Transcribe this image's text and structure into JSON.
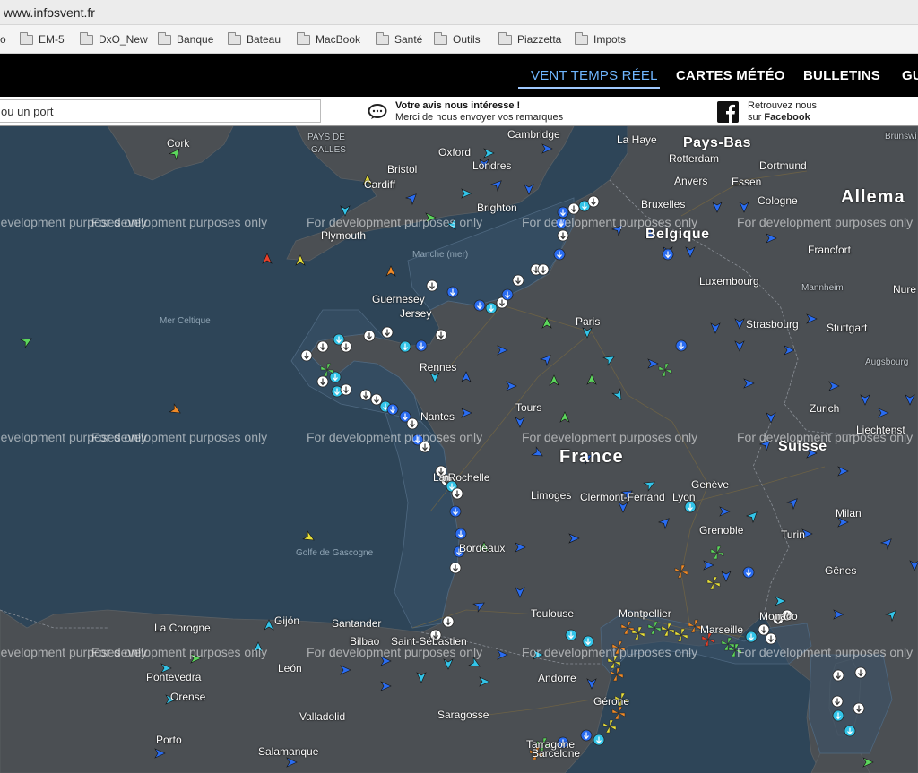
{
  "browser": {
    "url": "www.infosvent.fr"
  },
  "bookmarks": [
    {
      "label": "o",
      "folder": false
    },
    {
      "label": "EM-5",
      "folder": true
    },
    {
      "label": "DxO_New",
      "folder": true
    },
    {
      "label": "Banque",
      "folder": true
    },
    {
      "label": "Bateau",
      "folder": true
    },
    {
      "label": "MacBook",
      "folder": true
    },
    {
      "label": "Santé",
      "folder": true
    },
    {
      "label": "Outils",
      "folder": true
    },
    {
      "label": "Piazzetta",
      "folder": true
    },
    {
      "label": "Impots",
      "folder": true
    }
  ],
  "nav": {
    "items": [
      "VENT TEMPS RÉEL",
      "CARTES MÉTÉO",
      "BULLETINS",
      "GU"
    ],
    "active": "VENT TEMPS RÉEL"
  },
  "search": {
    "value": "ou un port",
    "placeholder": "ou un port"
  },
  "feedback": {
    "line1": "Votre avis nous intéresse !",
    "line2": "Merci de nous envoyer vos remarques",
    "icon": "speech-bubble-icon"
  },
  "facebook": {
    "line1": "Retrouvez nous",
    "line2_prefix": "sur",
    "line2_name": "Facebook",
    "icon": "facebook-icon"
  },
  "map": {
    "watermark": "For development purposes only",
    "labels": [
      {
        "text": "Cork",
        "cls": ""
      },
      {
        "text": "PAYS DE",
        "cls": "small"
      },
      {
        "text": "GALLES",
        "cls": "small"
      },
      {
        "text": "Oxford",
        "cls": ""
      },
      {
        "text": "Cambridge",
        "cls": ""
      },
      {
        "text": "Bristol",
        "cls": ""
      },
      {
        "text": "Londres",
        "cls": ""
      },
      {
        "text": "Cardiff",
        "cls": ""
      },
      {
        "text": "Brighton",
        "cls": ""
      },
      {
        "text": "Plymouth",
        "cls": ""
      },
      {
        "text": "Manche (mer)",
        "cls": "sea"
      },
      {
        "text": "Mer Celtique",
        "cls": "sea"
      },
      {
        "text": "Guernesey",
        "cls": ""
      },
      {
        "text": "Jersey",
        "cls": ""
      },
      {
        "text": "Rennes",
        "cls": ""
      },
      {
        "text": "Paris",
        "cls": ""
      },
      {
        "text": "Nantes",
        "cls": ""
      },
      {
        "text": "Tours",
        "cls": ""
      },
      {
        "text": "La Rochelle",
        "cls": ""
      },
      {
        "text": "Limoges",
        "cls": ""
      },
      {
        "text": "Clermont-Ferrand",
        "cls": ""
      },
      {
        "text": "Bordeaux",
        "cls": ""
      },
      {
        "text": "Golfe de Gascogne",
        "cls": "sea"
      },
      {
        "text": "Toulouse",
        "cls": ""
      },
      {
        "text": "Montpellier",
        "cls": ""
      },
      {
        "text": "Marseille",
        "cls": ""
      },
      {
        "text": "Monaco",
        "cls": ""
      },
      {
        "text": "Lyon",
        "cls": ""
      },
      {
        "text": "Grenoble",
        "cls": ""
      },
      {
        "text": "Genève",
        "cls": ""
      },
      {
        "text": "Strasbourg",
        "cls": ""
      },
      {
        "text": "Luxembourg",
        "cls": ""
      },
      {
        "text": "Belgique",
        "cls": "big"
      },
      {
        "text": "Bruxelles",
        "cls": ""
      },
      {
        "text": "Anvers",
        "cls": ""
      },
      {
        "text": "Rotterdam",
        "cls": ""
      },
      {
        "text": "La Haye",
        "cls": ""
      },
      {
        "text": "Pays-Bas",
        "cls": "big"
      },
      {
        "text": "Dortmund",
        "cls": ""
      },
      {
        "text": "Essen",
        "cls": ""
      },
      {
        "text": "Cologne",
        "cls": ""
      },
      {
        "text": "Allema",
        "cls": "huge"
      },
      {
        "text": "Francfort",
        "cls": ""
      },
      {
        "text": "Mannheim",
        "cls": "small"
      },
      {
        "text": "Stuttgart",
        "cls": ""
      },
      {
        "text": "Augsbourg",
        "cls": "small"
      },
      {
        "text": "Nure",
        "cls": ""
      },
      {
        "text": "Brunswi",
        "cls": "small"
      },
      {
        "text": "Zurich",
        "cls": ""
      },
      {
        "text": "Liechtenst",
        "cls": ""
      },
      {
        "text": "Suisse",
        "cls": "big"
      },
      {
        "text": "Milan",
        "cls": ""
      },
      {
        "text": "Turin",
        "cls": ""
      },
      {
        "text": "Gênes",
        "cls": ""
      },
      {
        "text": "France",
        "cls": "huge"
      },
      {
        "text": "La Corogne",
        "cls": ""
      },
      {
        "text": "Gijón",
        "cls": ""
      },
      {
        "text": "Santander",
        "cls": ""
      },
      {
        "text": "Bilbao",
        "cls": ""
      },
      {
        "text": "Saint-Sébastien",
        "cls": ""
      },
      {
        "text": "León",
        "cls": ""
      },
      {
        "text": "Pontevedra",
        "cls": ""
      },
      {
        "text": "Orense",
        "cls": ""
      },
      {
        "text": "Valladolid",
        "cls": ""
      },
      {
        "text": "Saragosse",
        "cls": ""
      },
      {
        "text": "Andorre",
        "cls": ""
      },
      {
        "text": "Gérone",
        "cls": ""
      },
      {
        "text": "Barcelone",
        "cls": ""
      },
      {
        "text": "Tarragone",
        "cls": ""
      },
      {
        "text": "Porto",
        "cls": ""
      },
      {
        "text": "Salamanque",
        "cls": ""
      }
    ],
    "colors": {
      "sea": "#2e4558",
      "land": "#4a4e52",
      "zone": "#3a526a",
      "arrow_blue": "#2a6cf0",
      "arrow_cyan": "#33c4e8",
      "arrow_green": "#5cd65c",
      "arrow_yellow": "#e8e03a",
      "arrow_orange": "#f08a28",
      "arrow_red": "#e8402a"
    }
  }
}
